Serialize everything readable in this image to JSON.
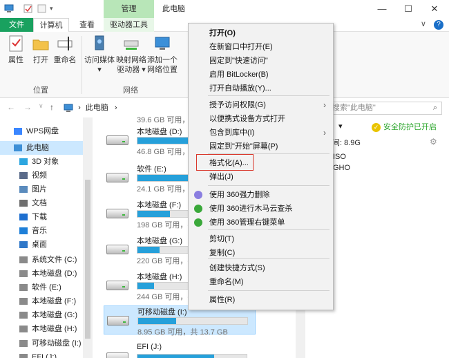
{
  "window": {
    "title": "此电脑",
    "context_tab": "管理",
    "controls": {
      "minimize": "—",
      "maximize": "☐",
      "close": "✕"
    }
  },
  "ribbon_tabs": {
    "file": "文件",
    "computer": "计算机",
    "view": "查看",
    "drive_tools": "驱动器工具",
    "expand": "∨",
    "help": "?"
  },
  "ribbon": {
    "properties": "属性",
    "open": "打开",
    "rename": "重命名",
    "access_media_1": "访问媒体",
    "access_media_2": "▾",
    "map_drive_1": "映射网络",
    "map_drive_2": "驱动器 ▾",
    "add_location_1": "添加一个",
    "add_location_2": "网络位置",
    "group_location": "位置",
    "group_network": "网络"
  },
  "address": {
    "back": "←",
    "forward": "→",
    "dropdown": "∨",
    "up": "↑",
    "path": "此电脑",
    "path_sep": "›",
    "search_placeholder": "搜索\"此电脑\"",
    "search_icon": "⌕"
  },
  "nav_pane": {
    "items": [
      {
        "label": "WPS网盘",
        "icon": "cloud-icon"
      },
      {
        "label": "此电脑",
        "icon": "computer-icon"
      },
      {
        "label": "3D 对象",
        "icon": "cube-icon"
      },
      {
        "label": "视频",
        "icon": "video-icon"
      },
      {
        "label": "图片",
        "icon": "picture-icon"
      },
      {
        "label": "文档",
        "icon": "document-icon"
      },
      {
        "label": "下载",
        "icon": "download-icon"
      },
      {
        "label": "音乐",
        "icon": "music-icon"
      },
      {
        "label": "桌面",
        "icon": "desktop-icon"
      },
      {
        "label": "系统文件 (C:)",
        "icon": "drive-icon"
      },
      {
        "label": "本地磁盘 (D:)",
        "icon": "drive-icon"
      },
      {
        "label": "软件 (E:)",
        "icon": "drive-icon"
      },
      {
        "label": "本地磁盘 (F:)",
        "icon": "drive-icon"
      },
      {
        "label": "本地磁盘 (G:)",
        "icon": "drive-icon"
      },
      {
        "label": "本地磁盘 (H:)",
        "icon": "drive-icon"
      },
      {
        "label": "可移动磁盘 (I:)",
        "icon": "usb-drive-icon"
      },
      {
        "label": "EFI (J:)",
        "icon": "drive-icon"
      }
    ]
  },
  "drives": [
    {
      "name": "本地磁盘 (D:)",
      "info": "46.8 GB 可用，共",
      "used": 0.5
    },
    {
      "name": "软件 (E:)",
      "info": "24.1 GB 可用，共",
      "used": 0.55
    },
    {
      "name": "本地磁盘 (F:)",
      "info": "198 GB 可用，共",
      "used": 0.3
    },
    {
      "name": "本地磁盘 (G:)",
      "info": "220 GB 可用，共",
      "used": 0.2
    },
    {
      "name": "本地磁盘 (H:)",
      "info": "244 GB 可用，共",
      "used": 0.15
    },
    {
      "name": "可移动磁盘 (I:)",
      "info": "8.95 GB 可用，共 13.7 GB",
      "used": 0.35
    },
    {
      "name": "EFI (J:)",
      "info": "",
      "used": 0.7
    }
  ],
  "drives_partial_top": "39.6 GB 可用，共",
  "right_panel": {
    "safe_label": "安全防护已开启",
    "space_label": "空间: 8.9G",
    "file1": "ISO",
    "file2": "GHO",
    "drop": "▾"
  },
  "context_menu": {
    "items": [
      {
        "label": "打开(O)",
        "bold": true
      },
      {
        "label": "在新窗口中打开(E)"
      },
      {
        "label": "固定到\"快速访问\""
      },
      {
        "label": "启用 BitLocker(B)"
      },
      {
        "label": "打开自动播放(Y)..."
      },
      {
        "label": "授予访问权限(G)",
        "submenu": true
      },
      {
        "label": "以便携式设备方式打开"
      },
      {
        "label": "包含到库中(I)",
        "submenu": true
      },
      {
        "label": "固定到\"开始\"屏幕(P)"
      },
      {
        "label": "格式化(A)..."
      },
      {
        "label": "弹出(J)"
      },
      {
        "label": "使用 360强力删除"
      },
      {
        "label": "使用 360进行木马云查杀"
      },
      {
        "label": "使用 360管理右键菜单"
      },
      {
        "label": "剪切(T)"
      },
      {
        "label": "复制(C)"
      },
      {
        "label": "创建快捷方式(S)"
      },
      {
        "label": "重命名(M)"
      },
      {
        "label": "属性(R)"
      }
    ],
    "submenu_arrow": "›"
  },
  "colors": {
    "accent_green": "#19a15f",
    "manage_green": "#b8e6b8",
    "selection_blue": "#cce8ff",
    "bar_blue": "#26a0da",
    "highlight_red": "#d9382c"
  }
}
